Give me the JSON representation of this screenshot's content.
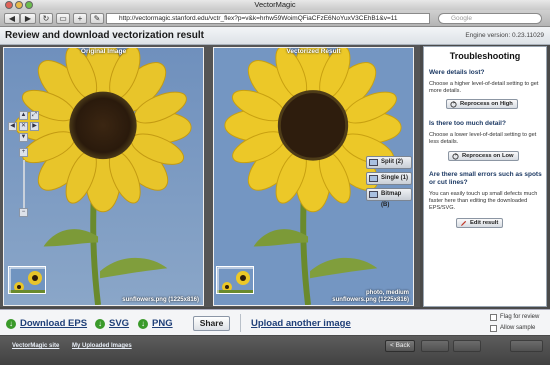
{
  "window": {
    "title": "VectorMagic"
  },
  "browser": {
    "url": "http://vectormagic.stanford.edu/vctr_flex?p=v&k=hrhw59WoimQFiaCFzE6NoYuxV3CEhB1&v=11",
    "search_placeholder": "Google"
  },
  "header": {
    "title": "Review and download vectorization result",
    "engine_version": "Engine version: 0.23.11029"
  },
  "original_panel": {
    "title": "Original Image",
    "caption": "sunflowers.png (1225x816)"
  },
  "vectorized_panel": {
    "title": "Vectorized Result",
    "caption_line1": "photo, medium",
    "caption_line2": "sunflowers.png (1225x816)",
    "view_buttons": [
      "Split (2)",
      "Single (1)",
      "Bitmap (B)"
    ]
  },
  "troubleshooting": {
    "title": "Troubleshooting",
    "sections": [
      {
        "question": "Were details lost?",
        "text": "Choose a higher level-of-detail setting to get more details.",
        "button": "Reprocess on High"
      },
      {
        "question": "Is there too much detail?",
        "text": "Choose a lower level-of-detail setting to get less details.",
        "button": "Reprocess on Low"
      },
      {
        "question": "Are there small errors such as spots or cut lines?",
        "text": "You can easily touch up small defects much faster here than editing the downloaded EPS/SVG.",
        "button": "Edit result"
      }
    ]
  },
  "downloads": {
    "eps": "Download EPS",
    "svg": "SVG",
    "png": "PNG",
    "share": "Share",
    "upload": "Upload another image",
    "flag_label": "Flag for review",
    "allow_label": "Allow sample"
  },
  "footer": {
    "site_link": "VectorMagic site",
    "uploads_link": "My Uploaded Images",
    "back_button": "< Back"
  }
}
